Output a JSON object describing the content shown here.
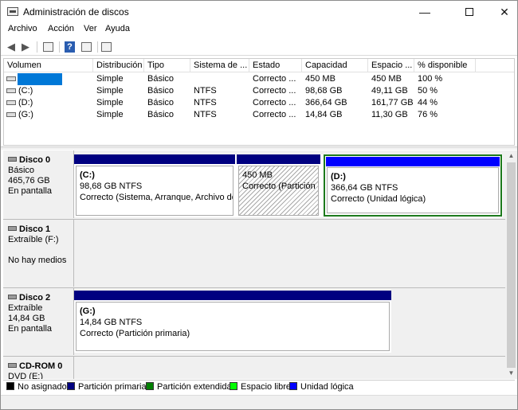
{
  "window": {
    "title": "Administración de discos",
    "controls": {
      "minimize": "—",
      "close": "✕"
    }
  },
  "menu": [
    "Archivo",
    "Acción",
    "Ver",
    "Ayuda"
  ],
  "toolbar": {
    "back_icon": "arrow-left-icon",
    "forward_icon": "arrow-right-icon",
    "help_glyph": "?"
  },
  "volumes": {
    "columns": [
      "Volumen",
      "Distribución",
      "Tipo",
      "Sistema de ...",
      "Estado",
      "Capacidad",
      "Espacio ...",
      "% disponible"
    ],
    "rows": [
      [
        "",
        "Simple",
        "Básico",
        "",
        "Correcto ...",
        "450 MB",
        "450 MB",
        "100 %"
      ],
      [
        "(C:)",
        "Simple",
        "Básico",
        "NTFS",
        "Correcto ...",
        "98,68 GB",
        "49,11 GB",
        "50 %"
      ],
      [
        "(D:)",
        "Simple",
        "Básico",
        "NTFS",
        "Correcto ...",
        "366,64 GB",
        "161,77 GB",
        "44 %"
      ],
      [
        "(G:)",
        "Simple",
        "Básico",
        "NTFS",
        "Correcto ...",
        "14,84 GB",
        "11,30 GB",
        "76 %"
      ]
    ]
  },
  "disks": [
    {
      "name": "Disco 0",
      "info": [
        "Básico",
        "465,76 GB",
        "En pantalla"
      ],
      "partitions": [
        {
          "name": "(C:)",
          "size": "98,68 GB NTFS",
          "status": "Correcto (Sistema, Arranque, Archivo de p"
        },
        {
          "name": "",
          "size": "450 MB",
          "status": "Correcto (Partición d"
        },
        {
          "name": "(D:)",
          "size": "366,64 GB NTFS",
          "status": "Correcto (Unidad lógica)"
        }
      ]
    },
    {
      "name": "Disco 1",
      "info": [
        "Extraíble (F:)",
        "",
        "No hay medios"
      ],
      "partitions": []
    },
    {
      "name": "Disco 2",
      "info": [
        "Extraíble",
        "14,84 GB",
        "En pantalla"
      ],
      "partitions": [
        {
          "name": "(G:)",
          "size": "14,84 GB NTFS",
          "status": "Correcto (Partición primaria)"
        }
      ]
    },
    {
      "name": "CD-ROM 0",
      "info": [
        "DVD (E:)"
      ],
      "partitions": []
    }
  ],
  "legend": [
    {
      "label": "No asignado",
      "color": "#000000"
    },
    {
      "label": "Partición primaria",
      "color": "#000080"
    },
    {
      "label": "Partición extendida",
      "color": "#008000"
    },
    {
      "label": "Espacio libre",
      "color": "#00ff00"
    },
    {
      "label": "Unidad lógica",
      "color": "#0000ff"
    }
  ]
}
